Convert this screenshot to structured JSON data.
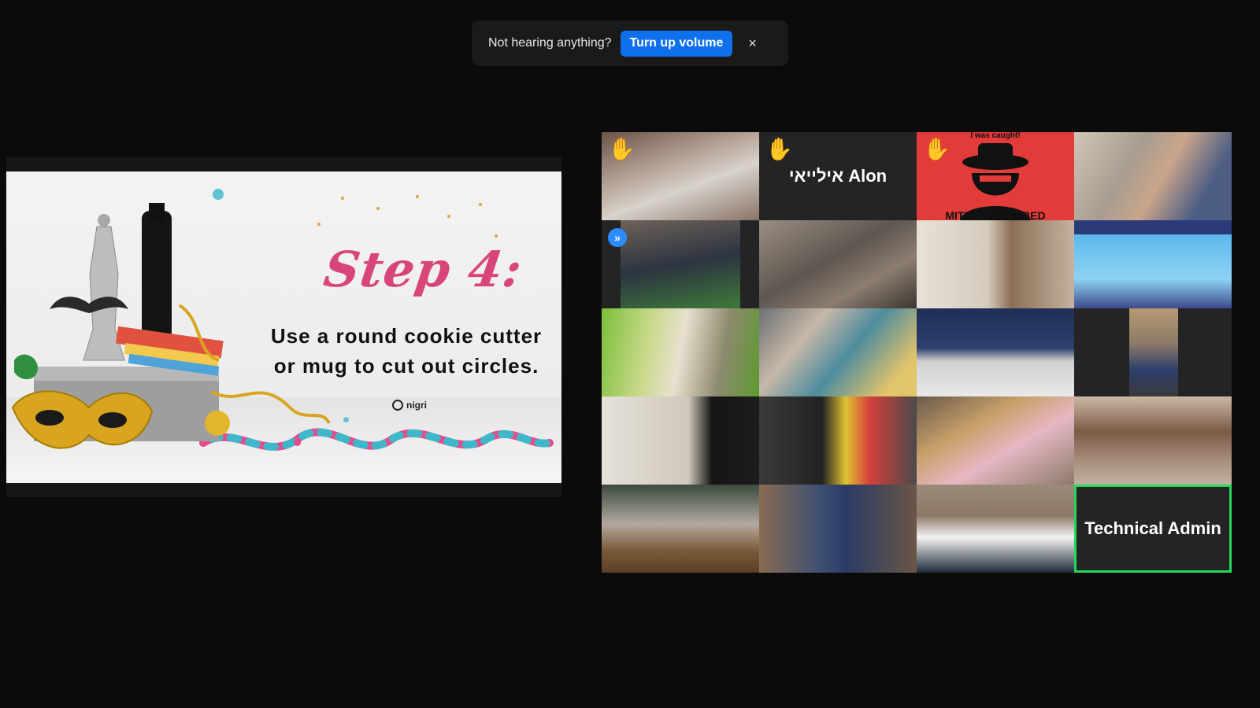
{
  "notification": {
    "text": "Not hearing anything?",
    "button_label": "Turn up volume",
    "close_symbol": "×"
  },
  "slide": {
    "title": "Step 4:",
    "body_line1": "Use a round cookie cutter",
    "body_line2": "or mug to cut out circles.",
    "logo_text": "nigri"
  },
  "grid": {
    "tiles": [
      {
        "name": "",
        "raised_hand": true
      },
      {
        "name": "אילייאי Alon",
        "raised_hand": true
      },
      {
        "name": "",
        "raised_hand": true,
        "banner_top": "I was caught!",
        "banner_bottom": "MITZVAH MOBBED"
      },
      {
        "name": "",
        "raised_hand": false
      },
      {
        "name": "",
        "raised_hand": false,
        "badge": "»"
      },
      {
        "name": "",
        "raised_hand": false
      },
      {
        "name": "",
        "raised_hand": false
      },
      {
        "name": "",
        "raised_hand": false
      },
      {
        "name": "",
        "raised_hand": false
      },
      {
        "name": "",
        "raised_hand": false
      },
      {
        "name": "",
        "raised_hand": false
      },
      {
        "name": "",
        "raised_hand": false
      },
      {
        "name": "",
        "raised_hand": false
      },
      {
        "name": "",
        "raised_hand": false
      },
      {
        "name": "",
        "raised_hand": false
      },
      {
        "name": "",
        "raised_hand": false
      },
      {
        "name": "",
        "raised_hand": false
      },
      {
        "name": "",
        "raised_hand": false
      },
      {
        "name": "",
        "raised_hand": false
      },
      {
        "name": "Technical Admin",
        "raised_hand": false,
        "active_speaker": true
      }
    ],
    "raised_hand_icon": "✋",
    "active_speaker_color": "#23d959"
  },
  "colors": {
    "accent": "#0e71eb",
    "slide_title": "#d8457a",
    "background": "#0b0b0c"
  }
}
